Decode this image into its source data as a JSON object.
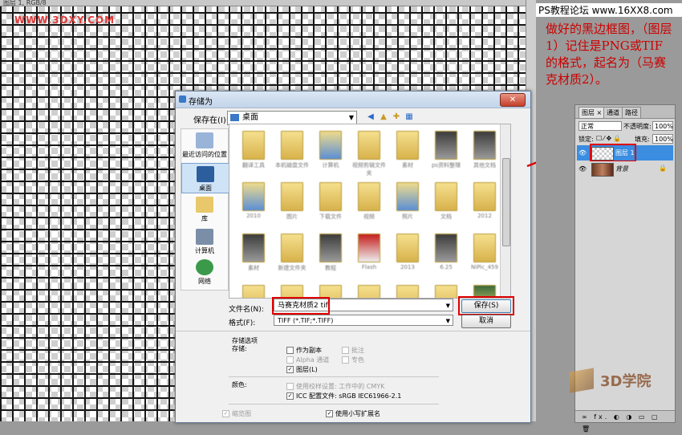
{
  "canvas": {
    "doc_title": "图层 1, RGB/8",
    "watermark": "WWW.3DXY.COM"
  },
  "annotation": {
    "site": "PS教程论坛 www.16XX8.com",
    "text": "做好的黑边框图，（图层1）记住是PNG或TIF的格式，起名为（马赛克材质2）。"
  },
  "dialog": {
    "title": "存储为",
    "close_label": "✕",
    "save_in_label": "保存在(I):",
    "save_in_value": "桌面",
    "places": [
      {
        "label": "最近访问的位置",
        "icon": "recent-places-icon"
      },
      {
        "label": "桌面",
        "icon": "desktop-icon"
      },
      {
        "label": "库",
        "icon": "library-icon"
      },
      {
        "label": "计算机",
        "icon": "computer-icon"
      },
      {
        "label": "网络",
        "icon": "network-icon"
      }
    ],
    "files": [
      {
        "label": "翻译工具",
        "kind": "folder"
      },
      {
        "label": "本机磁盘文件",
        "kind": "folder"
      },
      {
        "label": "计算机",
        "kind": "folder-blue"
      },
      {
        "label": "视频剪辑文件夹",
        "kind": "folder"
      },
      {
        "label": "素材",
        "kind": "folder"
      },
      {
        "label": "ps资料整理",
        "kind": "dark"
      },
      {
        "label": "其他文档",
        "kind": "dark"
      },
      {
        "label": "2010",
        "kind": "folder-blue"
      },
      {
        "label": "图片",
        "kind": "folder"
      },
      {
        "label": "下载文件",
        "kind": "folder"
      },
      {
        "label": "视频",
        "kind": "folder"
      },
      {
        "label": "照片",
        "kind": "folder-blue"
      },
      {
        "label": "文档",
        "kind": "folder"
      },
      {
        "label": "2012",
        "kind": "folder"
      },
      {
        "label": "素材",
        "kind": "dark"
      },
      {
        "label": "新建文件夹",
        "kind": "folder"
      },
      {
        "label": "教程",
        "kind": "dark"
      },
      {
        "label": "Flash",
        "kind": "red"
      },
      {
        "label": "2013",
        "kind": "folder"
      },
      {
        "label": "6.25",
        "kind": "dark"
      },
      {
        "label": "NiPic_459",
        "kind": "folder"
      },
      {
        "label": "",
        "kind": "folder"
      },
      {
        "label": "",
        "kind": "folder"
      },
      {
        "label": "",
        "kind": "folder"
      },
      {
        "label": "",
        "kind": "folder"
      },
      {
        "label": "",
        "kind": "folder"
      },
      {
        "label": "",
        "kind": "folder"
      },
      {
        "label": "",
        "kind": "green"
      }
    ],
    "filename_label": "文件名(N):",
    "filename_value": "马赛克材质2 tif",
    "format_label": "格式(F):",
    "format_value": "TIFF (*.TIF;*.TIFF)",
    "save_button": "保存(S)",
    "cancel_button": "取消",
    "options": {
      "section_title": "存储选项",
      "save_label": "存储:",
      "as_copy": "作为副本",
      "notes": "批注",
      "alpha": "Alpha 通道",
      "spot": "专色",
      "layers": "图层(L)",
      "color_label": "颜色:",
      "use_proof": "使用校样设置: 工作中的 CMYK",
      "icc": "ICC 配置文件: sRGB IEC61966-2.1",
      "thumbnail": "缩览图",
      "lowercase_ext": "使用小写扩展名"
    }
  },
  "layers_panel": {
    "tabs": [
      "图层 ×",
      "通道",
      "路径"
    ],
    "blend_mode": "正常",
    "opacity_label": "不透明度:",
    "opacity_value": "100%",
    "lock_label": "锁定:",
    "fill_label": "填充:",
    "fill_value": "100%",
    "layers": [
      {
        "name": "图层 1",
        "selected": true
      },
      {
        "name": "背景",
        "selected": false
      }
    ],
    "bottom_icons": "∞ fx. ◐ ◑ ▭ ▢ 🗑"
  },
  "logo": {
    "text": "3D学院"
  },
  "colors": {
    "annotation": "#cc0000",
    "highlight": "#e00000",
    "selected_layer": "#3a8de0"
  }
}
